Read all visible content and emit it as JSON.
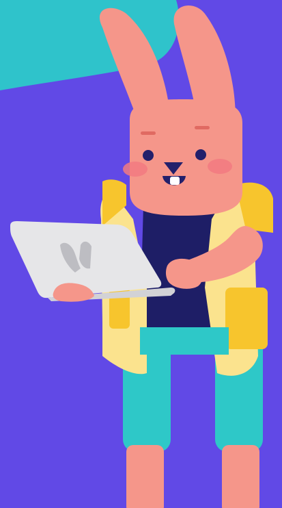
{
  "scene": {
    "subject": "pink-bunny-mascot-with-laptop",
    "palette": {
      "background": "#6149E6",
      "corner_shape": "#2FC3CB",
      "bunny_skin": "#F5968A",
      "bunny_skin_dark": "#E8847A",
      "eyes": "#23206B",
      "cheeks": "#F27A80",
      "brows": "#E06A62",
      "shirt": "#1E1E66",
      "vest": "#FBE38E",
      "vest_trim": "#F7C52D",
      "pants": "#2EC8C8",
      "laptop": "#E6E6E8",
      "laptop_logo": "#BDBDC2"
    }
  }
}
